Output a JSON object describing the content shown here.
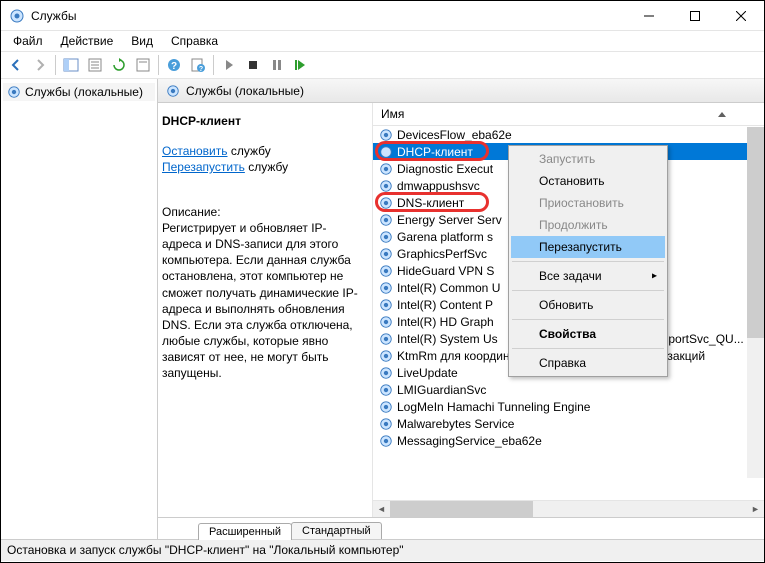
{
  "window": {
    "title": "Службы"
  },
  "menu": {
    "file": "Файл",
    "action": "Действие",
    "view": "Вид",
    "help": "Справка"
  },
  "tree": {
    "root": "Службы (локальные)"
  },
  "header": {
    "title": "Службы (локальные)"
  },
  "detail": {
    "name": "DHCP-клиент",
    "stop_verb": "Остановить",
    "stop_obj": " службу",
    "restart_verb": "Перезапустить",
    "restart_obj": " службу",
    "desc_h": "Описание:",
    "desc": "Регистрирует и обновляет IP-адреса и DNS-записи для этого компьютера. Если данная служба остановлена, этот компьютер не сможет получать динамические IP-адреса и выполнять обновления DNS. Если эта служба отключена, любые службы, которые явно зависят от нее, не могут быть запущены."
  },
  "column": {
    "name": "Имя"
  },
  "services": [
    {
      "label": "DevicesFlow_eba62e"
    },
    {
      "label": "DHCP-клиент",
      "selected": true,
      "highlighted": true
    },
    {
      "label": "Diagnostic Execut"
    },
    {
      "label": "dmwappushsvc"
    },
    {
      "label": "DNS-клиент",
      "highlighted": true
    },
    {
      "label": "Energy Server Serv"
    },
    {
      "label": "Garena platform s"
    },
    {
      "label": "GraphicsPerfSvc"
    },
    {
      "label": "HideGuard VPN S"
    },
    {
      "label": "Intel(R) Common U"
    },
    {
      "label": "Intel(R) Content P"
    },
    {
      "label": "Intel(R) HD Graph"
    },
    {
      "label": "Intel(R) System Us",
      "suffix": "ReportSvc_QU..."
    },
    {
      "label": "KtmRm для координатора распределенных транзакций"
    },
    {
      "label": "LiveUpdate"
    },
    {
      "label": "LMIGuardianSvc"
    },
    {
      "label": "LogMeIn Hamachi Tunneling Engine"
    },
    {
      "label": "Malwarebytes Service"
    },
    {
      "label": "MessagingService_eba62e"
    }
  ],
  "context_menu": {
    "start": "Запустить",
    "stop": "Остановить",
    "pause": "Приостановить",
    "resume": "Продолжить",
    "restart": "Перезапустить",
    "all_tasks": "Все задачи",
    "refresh": "Обновить",
    "properties": "Свойства",
    "help": "Справка"
  },
  "tabs": {
    "extended": "Расширенный",
    "standard": "Стандартный"
  },
  "statusbar": "Остановка и запуск службы \"DHCP-клиент\" на \"Локальный компьютер\""
}
